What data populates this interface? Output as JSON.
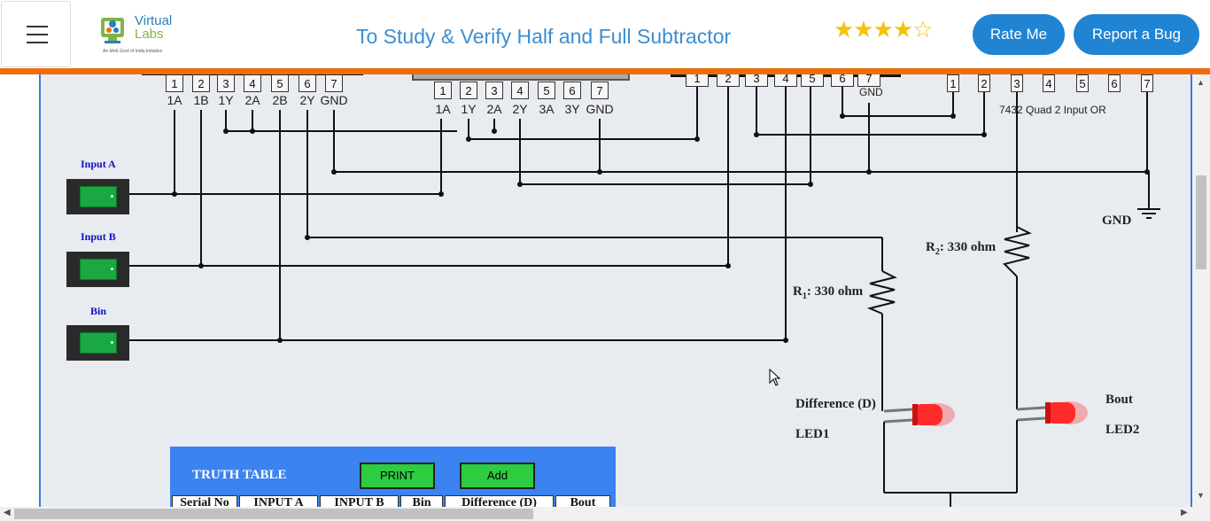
{
  "header": {
    "menu_icon": "hamburger-menu-icon",
    "logo": {
      "line1": "Virtual",
      "line2": "Labs",
      "tagline": "An MoE Govt of India Initiative"
    },
    "title": "To Study & Verify Half and Full Subtractor",
    "rating": {
      "value": 4,
      "max": 5,
      "full": "★★★★",
      "empty": "☆"
    },
    "rate_button": "Rate Me",
    "bug_button": "Report a Bug"
  },
  "colors": {
    "accent": "#2184d2",
    "bar": "#ef6c0b",
    "title": "#3d8ed0",
    "switch_on": "#1aa842",
    "led": "#ff2a2a"
  },
  "inputs": [
    {
      "label": "Input A"
    },
    {
      "label": "Input B"
    },
    {
      "label": "Bin"
    }
  ],
  "ic1": {
    "pins": [
      "1",
      "2",
      "3",
      "4",
      "5",
      "6",
      "7"
    ],
    "pin_names": [
      "1A",
      "1B",
      "1Y",
      "2A",
      "2B",
      "2Y",
      "GND"
    ]
  },
  "ic2": {
    "pins": [
      "1",
      "2",
      "3",
      "4",
      "5",
      "6",
      "7"
    ],
    "pin_names": [
      "1A",
      "1Y",
      "2A",
      "2Y",
      "3A",
      "3Y",
      "GND"
    ]
  },
  "ic3": {
    "pins": [
      "1",
      "2",
      "3",
      "4",
      "5",
      "6",
      "7"
    ],
    "gnd_label": "GND"
  },
  "ic4": {
    "pins": [
      "1",
      "2",
      "3",
      "4",
      "5",
      "6",
      "7"
    ],
    "name": "7432 Quad 2 Input OR"
  },
  "circuit": {
    "gnd_label": "GND",
    "r1": {
      "prefix": "R",
      "sub": "1",
      "value": ": 330 ohm"
    },
    "r2": {
      "prefix": "R",
      "sub": "2",
      "value": ": 330 ohm"
    },
    "led1": {
      "output": "Difference (D)",
      "name": "LED1"
    },
    "led2": {
      "output": "Bout",
      "name": "LED2"
    }
  },
  "truth_table": {
    "title": "TRUTH TABLE",
    "print_button": "PRINT",
    "add_button": "Add",
    "columns": [
      "Serial No",
      "INPUT A",
      "INPUT B",
      "Bin",
      "Difference (D)",
      "Bout"
    ]
  }
}
